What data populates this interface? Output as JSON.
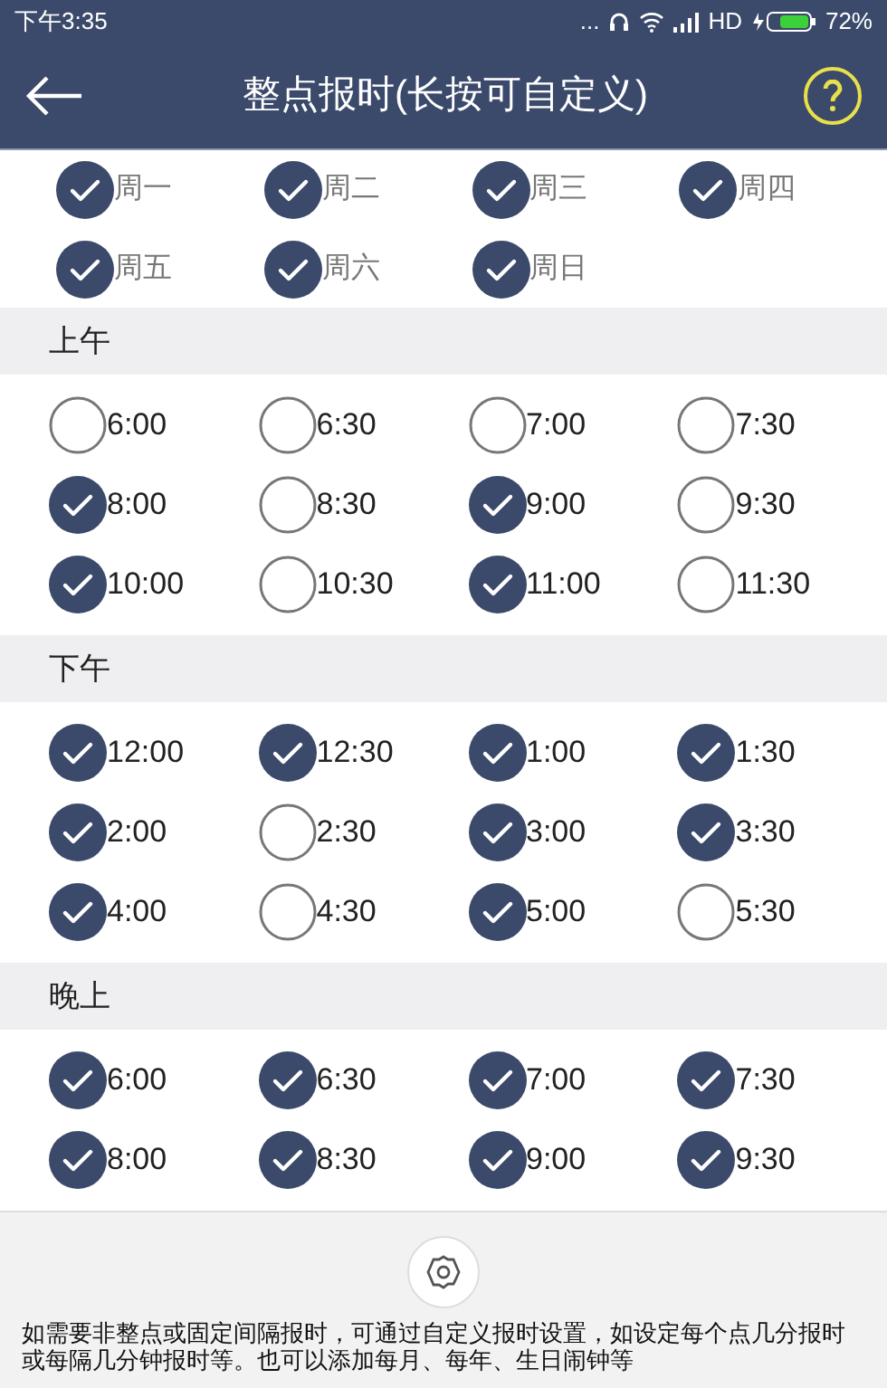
{
  "status_bar": {
    "time": "下午3:35",
    "dots": "...",
    "network": "HD",
    "battery": "72%"
  },
  "header": {
    "title": "整点报时(长按可自定义)"
  },
  "days": [
    {
      "label": "周一",
      "checked": true
    },
    {
      "label": "周二",
      "checked": true
    },
    {
      "label": "周三",
      "checked": true
    },
    {
      "label": "周四",
      "checked": true
    },
    {
      "label": "周五",
      "checked": true
    },
    {
      "label": "周六",
      "checked": true
    },
    {
      "label": "周日",
      "checked": true
    }
  ],
  "sections": [
    {
      "title": "上午",
      "times": [
        {
          "label": "6:00",
          "checked": false
        },
        {
          "label": "6:30",
          "checked": false
        },
        {
          "label": "7:00",
          "checked": false
        },
        {
          "label": "7:30",
          "checked": false
        },
        {
          "label": "8:00",
          "checked": true
        },
        {
          "label": "8:30",
          "checked": false
        },
        {
          "label": "9:00",
          "checked": true
        },
        {
          "label": "9:30",
          "checked": false
        },
        {
          "label": "10:00",
          "checked": true
        },
        {
          "label": "10:30",
          "checked": false
        },
        {
          "label": "11:00",
          "checked": true
        },
        {
          "label": "11:30",
          "checked": false
        }
      ]
    },
    {
      "title": "下午",
      "times": [
        {
          "label": "12:00",
          "checked": true
        },
        {
          "label": "12:30",
          "checked": true
        },
        {
          "label": "1:00",
          "checked": true
        },
        {
          "label": "1:30",
          "checked": true
        },
        {
          "label": "2:00",
          "checked": true
        },
        {
          "label": "2:30",
          "checked": false
        },
        {
          "label": "3:00",
          "checked": true
        },
        {
          "label": "3:30",
          "checked": true
        },
        {
          "label": "4:00",
          "checked": true
        },
        {
          "label": "4:30",
          "checked": false
        },
        {
          "label": "5:00",
          "checked": true
        },
        {
          "label": "5:30",
          "checked": false
        }
      ]
    },
    {
      "title": "晚上",
      "times": [
        {
          "label": "6:00",
          "checked": true
        },
        {
          "label": "6:30",
          "checked": true
        },
        {
          "label": "7:00",
          "checked": true
        },
        {
          "label": "7:30",
          "checked": true
        },
        {
          "label": "8:00",
          "checked": true
        },
        {
          "label": "8:30",
          "checked": true
        },
        {
          "label": "9:00",
          "checked": true
        },
        {
          "label": "9:30",
          "checked": true
        }
      ]
    }
  ],
  "footer": {
    "text": "如需要非整点或固定间隔报时，可通过自定义报时设置，如设定每个点几分报时或每隔几分钟报时等。也可以添加每月、每年、生日闹钟等"
  }
}
